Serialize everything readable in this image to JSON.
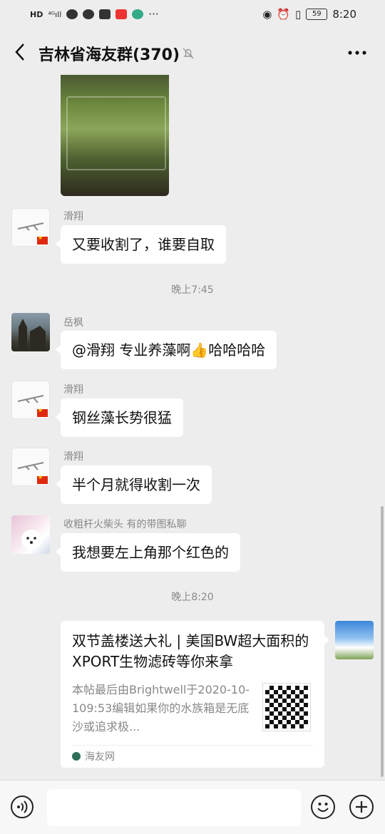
{
  "status_bar": {
    "left_icons": [
      "hd-icon",
      "4g-signal-icon",
      "chat-icon",
      "circle-icon",
      "image-icon",
      "app-icon",
      "cloud-icon",
      "more-dots"
    ],
    "battery": "59",
    "time": "8:20"
  },
  "header": {
    "title": "吉林省海友群(370)"
  },
  "messages": [
    {
      "sender": "滑翔",
      "text": "又要收割了，谁要自取"
    },
    {
      "sender": "岳枫",
      "text": "@滑翔  专业养藻啊👍哈哈哈哈"
    },
    {
      "sender": "滑翔",
      "text": "钢丝藻长势很猛"
    },
    {
      "sender": "滑翔",
      "text": "半个月就得收割一次"
    },
    {
      "sender": "收粗杆火柴头 有的带图私聊",
      "text": "我想要左上角那个红色的"
    }
  ],
  "timestamps": [
    "晚上7:45",
    "晚上8:20"
  ],
  "link_card": {
    "title": "双节盖楼送大礼 | 美国BW超大面积的XPORT生物滤砖等你来拿",
    "description": "本帖最后由Brightwell于2020-10-109:53编辑如果你的水族箱是无底沙或追求极...",
    "source": "海友网"
  },
  "input": {
    "value": "",
    "placeholder": ""
  }
}
